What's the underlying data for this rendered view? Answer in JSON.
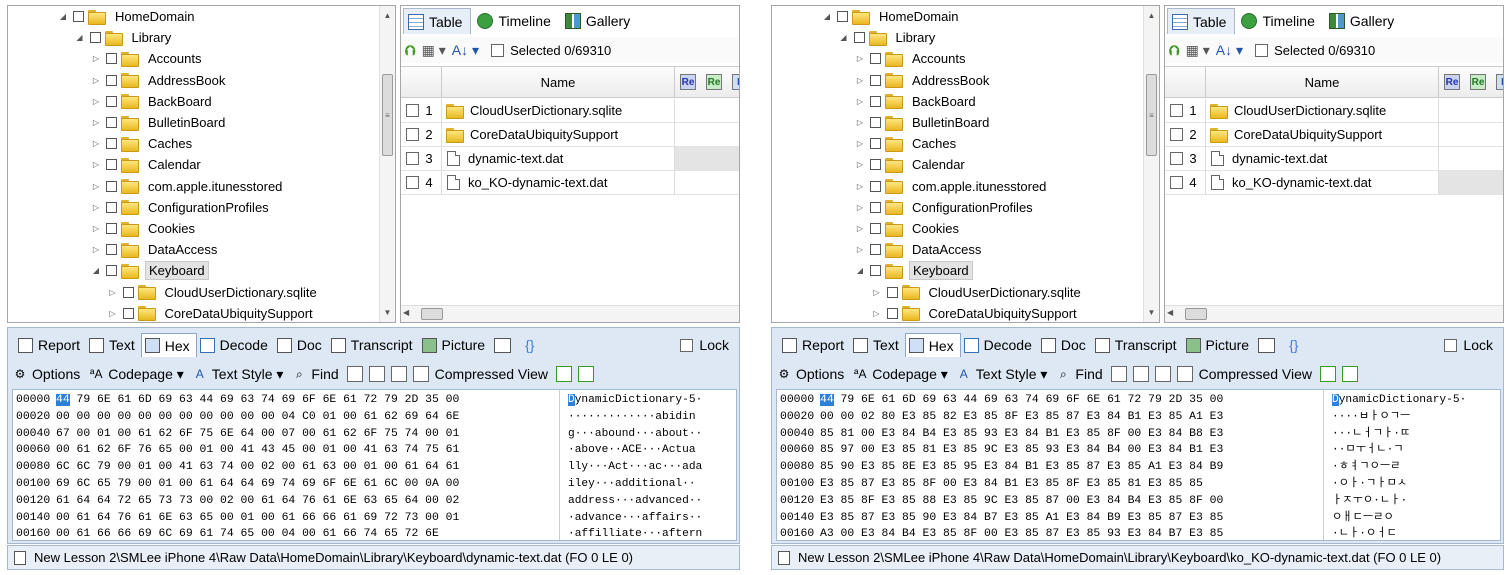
{
  "windows": [
    {
      "id": "left",
      "tree": [
        {
          "label": "HomeDomain",
          "level": 3,
          "expanded": true
        },
        {
          "label": "Library",
          "level": 4,
          "expanded": true
        },
        {
          "label": "Accounts",
          "level": 5,
          "expanded": false
        },
        {
          "label": "AddressBook",
          "level": 5,
          "expanded": false
        },
        {
          "label": "BackBoard",
          "level": 5,
          "expanded": false
        },
        {
          "label": "BulletinBoard",
          "level": 5,
          "expanded": false
        },
        {
          "label": "Caches",
          "level": 5,
          "expanded": false
        },
        {
          "label": "Calendar",
          "level": 5,
          "expanded": false
        },
        {
          "label": "com.apple.itunesstored",
          "level": 5,
          "expanded": false
        },
        {
          "label": "ConfigurationProfiles",
          "level": 5,
          "expanded": false
        },
        {
          "label": "Cookies",
          "level": 5,
          "expanded": false
        },
        {
          "label": "DataAccess",
          "level": 5,
          "expanded": false
        },
        {
          "label": "Keyboard",
          "level": 5,
          "expanded": true,
          "selected": true
        },
        {
          "label": "CloudUserDictionary.sqlite",
          "level": 6,
          "expanded": false
        },
        {
          "label": "CoreDataUbiquitySupport",
          "level": 6,
          "expanded": false
        }
      ],
      "tabs": [
        "Table",
        "Timeline",
        "Gallery"
      ],
      "selected_text": "Selected 0/69310",
      "name_header": "Name",
      "mini_cols": [
        "Re",
        "Re",
        "F"
      ],
      "files": [
        {
          "num": "1",
          "name": "CloudUserDictionary.sqlite",
          "type": "folder"
        },
        {
          "num": "2",
          "name": "CoreDataUbiquitySupport",
          "type": "folder"
        },
        {
          "num": "3",
          "name": "dynamic-text.dat",
          "type": "file",
          "highlight": true
        },
        {
          "num": "4",
          "name": "ko_KO-dynamic-text.dat",
          "type": "file"
        }
      ],
      "view_tabs": [
        "Report",
        "Text",
        "Hex",
        "Decode",
        "Doc",
        "Transcript",
        "Picture",
        "",
        "{}"
      ],
      "lock": "Lock",
      "hex_toolbar": [
        "Options",
        "Codepage",
        "Text Style",
        "Find",
        "Compressed View"
      ],
      "hex": [
        {
          "off": "00000",
          "first": "44",
          "rest": " 79 6E 61 6D 69 63 44 69 63 74 69 6F 6E 61 72 79 2D 35 00",
          "asciiFirst": "D",
          "ascii": "ynamicDictionary-5·"
        },
        {
          "off": "00020",
          "bytes": "00 00 00 00 00 00 00 00 00 00 00 04 C0 01 00 61 62 69 64 6E",
          "ascii": "·············abidin"
        },
        {
          "off": "00040",
          "bytes": "67 00 01 00 61 62 6F 75 6E 64 00 07 00 61 62 6F 75 74 00 01",
          "ascii": "g···abound···about··"
        },
        {
          "off": "00060",
          "bytes": "00 61 62 6F 76 65 00 01 00 41 43 45 00 01 00 41 63 74 75 61",
          "ascii": "·above··ACE···Actua"
        },
        {
          "off": "00080",
          "bytes": "6C 6C 79 00 01 00 41 63 74 00 02 00 61 63 00 01 00 61 64 61",
          "ascii": "lly···Act···ac···ada"
        },
        {
          "off": "00100",
          "bytes": "69 6C 65 79 00 01 00 61 64 64 69 74 69 6F 6E 61 6C 00 0A 00",
          "ascii": "iley···additional··"
        },
        {
          "off": "00120",
          "bytes": "61 64 64 72 65 73 73 00 02 00 61 64 76 61 6E 63 65 64 00 02",
          "ascii": "address···advanced··"
        },
        {
          "off": "00140",
          "bytes": "00 61 64 76 61 6E 63 65 00 01 00 61 66 66 61 69 72 73 00 01",
          "ascii": "·advance···affairs··"
        },
        {
          "off": "00160",
          "bytes": "00 61 66 66 69 6C 69 61 74 65 00 04 00 61 66 74 65 72 6E",
          "ascii": "·affilliate···aftern"
        }
      ],
      "status": "New Lesson 2\\SMLee iPhone 4\\Raw Data\\HomeDomain\\Library\\Keyboard\\dynamic-text.dat (FO 0 LE 0)"
    },
    {
      "id": "right",
      "tree": [
        {
          "label": "HomeDomain",
          "level": 3,
          "expanded": true
        },
        {
          "label": "Library",
          "level": 4,
          "expanded": true
        },
        {
          "label": "Accounts",
          "level": 5,
          "expanded": false
        },
        {
          "label": "AddressBook",
          "level": 5,
          "expanded": false
        },
        {
          "label": "BackBoard",
          "level": 5,
          "expanded": false
        },
        {
          "label": "BulletinBoard",
          "level": 5,
          "expanded": false
        },
        {
          "label": "Caches",
          "level": 5,
          "expanded": false
        },
        {
          "label": "Calendar",
          "level": 5,
          "expanded": false
        },
        {
          "label": "com.apple.itunesstored",
          "level": 5,
          "expanded": false
        },
        {
          "label": "ConfigurationProfiles",
          "level": 5,
          "expanded": false
        },
        {
          "label": "Cookies",
          "level": 5,
          "expanded": false
        },
        {
          "label": "DataAccess",
          "level": 5,
          "expanded": false
        },
        {
          "label": "Keyboard",
          "level": 5,
          "expanded": true,
          "selected": true
        },
        {
          "label": "CloudUserDictionary.sqlite",
          "level": 6,
          "expanded": false
        },
        {
          "label": "CoreDataUbiquitySupport",
          "level": 6,
          "expanded": false
        }
      ],
      "tabs": [
        "Table",
        "Timeline",
        "Gallery"
      ],
      "selected_text": "Selected 0/69310",
      "name_header": "Name",
      "mini_cols": [
        "Re",
        "Re",
        "F"
      ],
      "files": [
        {
          "num": "1",
          "name": "CloudUserDictionary.sqlite",
          "type": "folder"
        },
        {
          "num": "2",
          "name": "CoreDataUbiquitySupport",
          "type": "folder"
        },
        {
          "num": "3",
          "name": "dynamic-text.dat",
          "type": "file"
        },
        {
          "num": "4",
          "name": "ko_KO-dynamic-text.dat",
          "type": "file",
          "highlight": true
        }
      ],
      "view_tabs": [
        "Report",
        "Text",
        "Hex",
        "Decode",
        "Doc",
        "Transcript",
        "Picture",
        "",
        "{}"
      ],
      "lock": "Lock",
      "hex_toolbar": [
        "Options",
        "Codepage",
        "Text Style",
        "Find",
        "Compressed View"
      ],
      "hex": [
        {
          "off": "00000",
          "first": "44",
          "rest": " 79 6E 61 6D 69 63 44 69 63 74 69 6F 6E 61 72 79 2D 35 00",
          "asciiFirst": "D",
          "ascii": "ynamicDictionary-5·"
        },
        {
          "off": "00020",
          "bytes": "00 00 02 80 E3 85 82 E3 85 8F E3 85 87 E3 84 B1 E3 85 A1 E3",
          "ascii": "····ㅂㅏㅇㄱㅡ"
        },
        {
          "off": "00040",
          "bytes": "85 81 00 E3 84 B4 E3 85 93 E3 84 B1 E3 85 8F 00 E3 84 B8 E3",
          "ascii": "···ㄴㅓㄱㅏ·ㄸ"
        },
        {
          "off": "00060",
          "bytes": "85 97 00 E3 85 81 E3 85 9C E3 85 93 E3 84 B4 00 E3 84 B1 E3",
          "ascii": "··ㅁㅜㅓㄴ·ㄱ"
        },
        {
          "off": "00080",
          "bytes": "85 90 E3 85 8E E3 85 95 E3 84 B1 E3 85 87 E3 85 A1 E3 84 B9",
          "ascii": "·ㅎㅕㄱㅇㅡㄹ"
        },
        {
          "off": "00100",
          "bytes": "E3 85 87 E3 85 8F 00 E3 84 B1 E3 85 8F E3 85 81 E3 85 85",
          "ascii": "·ㅇㅏ·ㄱㅏㅁㅅ"
        },
        {
          "off": "00120",
          "bytes": "E3 85 8F E3 85 88 E3 85 9C E3 85 87 00 E3 84 B4 E3 85 8F 00",
          "ascii": "ㅏㅈㅜㅇ·ㄴㅏ·"
        },
        {
          "off": "00140",
          "bytes": "E3 85 87 E3 85 90 E3 84 B7 E3 85 A1 E3 84 B9 E3 85 87 E3 85",
          "ascii": "ㅇㅐㄷㅡㄹㅇ"
        },
        {
          "off": "00160",
          "bytes": "A3 00 E3 84 B4 E3 85 8F 00 E3 85 87 E3 85 93 E3 84 B7 E3 85",
          "ascii": "·ㄴㅏ·ㅇㅓㄷ"
        }
      ],
      "status": "New Lesson 2\\SMLee iPhone 4\\Raw Data\\HomeDomain\\Library\\Keyboard\\ko_KO-dynamic-text.dat (FO 0 LE 0)"
    }
  ]
}
